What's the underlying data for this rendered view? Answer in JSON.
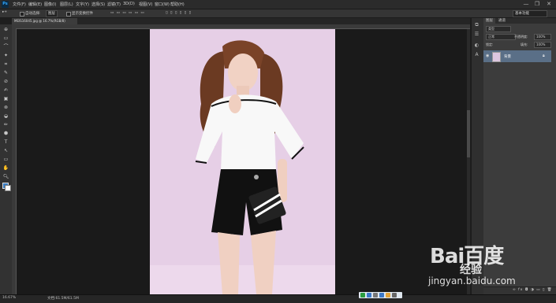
{
  "app": {
    "logo": "Ps"
  },
  "menu": [
    "文件(F)",
    "编辑(E)",
    "图像(I)",
    "图层(L)",
    "文字(Y)",
    "选择(S)",
    "滤镜(T)",
    "3D(D)",
    "视图(V)",
    "窗口(W)",
    "帮助(H)"
  ],
  "window_controls": {
    "minimize": "—",
    "restore": "❐",
    "close": "✕"
  },
  "options": {
    "auto_select_label": "自动选择:",
    "auto_select_value": "图层",
    "show_transform_label": "显示变换控件"
  },
  "document_tab": {
    "title": "MEIS16045.jpg @ 16.7%(RGB/8)"
  },
  "status": {
    "zoom": "16.67%",
    "doc_size": "文档:61.5M/61.5M"
  },
  "panels": {
    "tabs": [
      "图层",
      "通道"
    ],
    "kind_filter": "类型",
    "blend_mode": "正常",
    "opacity_label": "不透明度:",
    "opacity_value": "100%",
    "lock_label": "锁定:",
    "fill_label": "填充:",
    "fill_value": "100%",
    "layer_name": "背景",
    "workspace": "基本功能"
  },
  "watermark": {
    "brand": "Bai百度",
    "sub": "经验",
    "url": "jingyan.baidu.com"
  },
  "colors": {
    "foreground": "#3a7ec4",
    "background": "#ffffff",
    "layer_selected": "#5a6f87"
  }
}
